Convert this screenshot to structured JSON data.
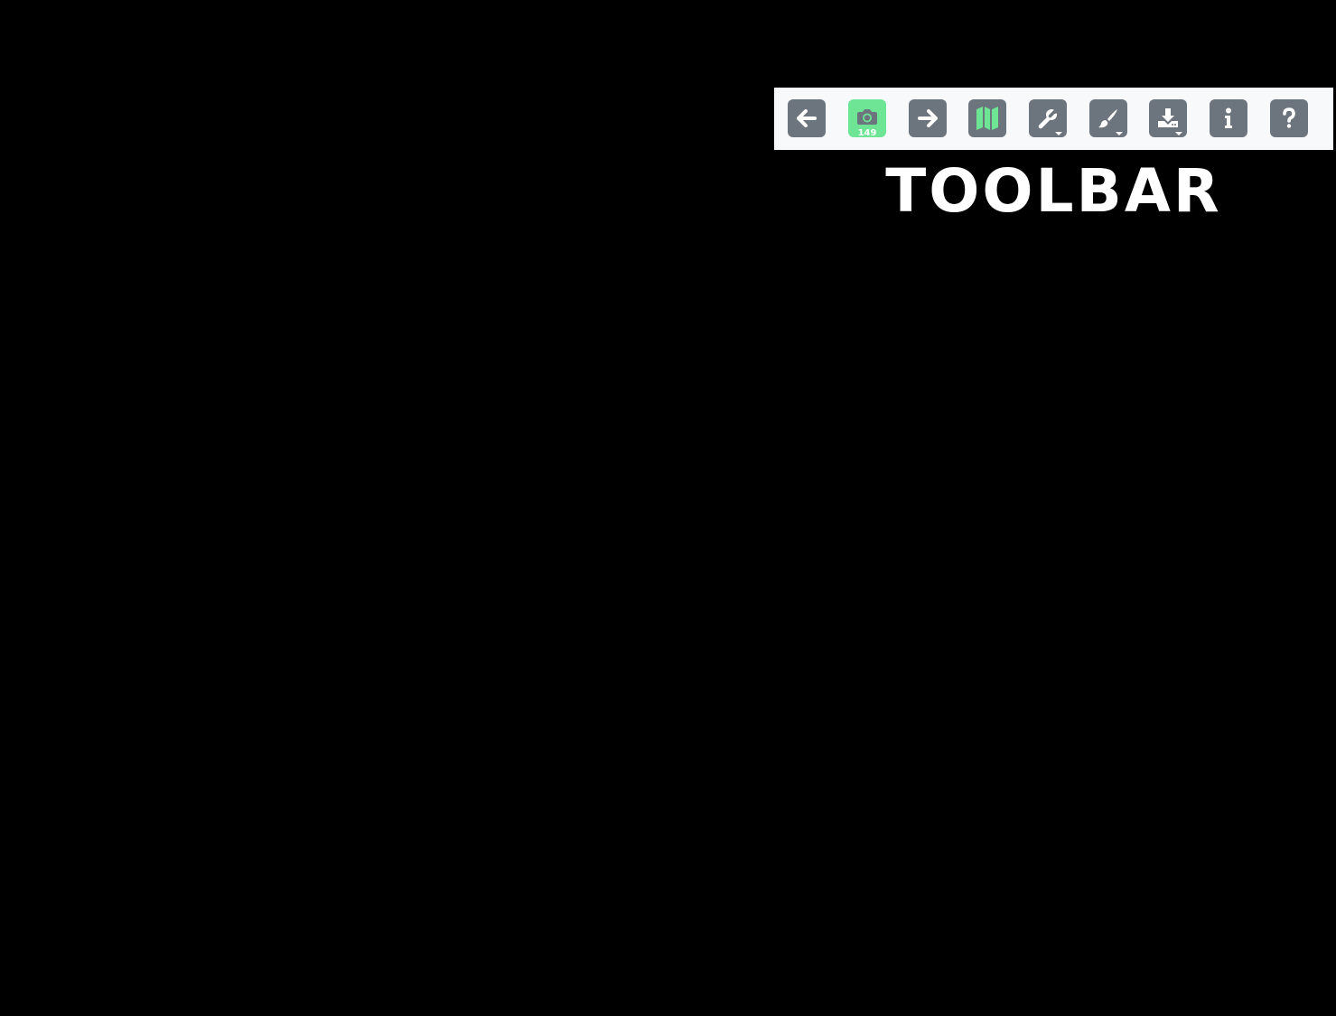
{
  "toolbar": {
    "buttons": [
      {
        "id": "back",
        "icon": "arrow-left-icon"
      },
      {
        "id": "photo",
        "icon": "camera-icon",
        "badge": "149",
        "active_color": "#6ee495"
      },
      {
        "id": "forward",
        "icon": "arrow-right-icon"
      },
      {
        "id": "map",
        "icon": "map-icon",
        "active_color": "#6ee495"
      },
      {
        "id": "tools",
        "icon": "wrench-icon",
        "has_dropdown": true
      },
      {
        "id": "paint",
        "icon": "paintbrush-icon",
        "has_dropdown": true
      },
      {
        "id": "download",
        "icon": "download-icon",
        "has_dropdown": true
      },
      {
        "id": "info",
        "icon": "info-icon"
      },
      {
        "id": "help",
        "icon": "question-icon"
      }
    ],
    "button_color": "#6c757d",
    "background_color": "#f8f9fa"
  },
  "caption": {
    "text": "TOOLBAR"
  }
}
